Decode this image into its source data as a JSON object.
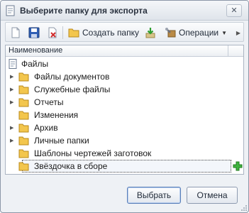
{
  "window": {
    "title": "Выберите папку для экспорта",
    "close_glyph": "✕"
  },
  "toolbar": {
    "create_folder_label": "Создать папку",
    "operations_label": "Операции",
    "operations_arrow": "▼",
    "overflow_glyph": "▶",
    "icons": [
      "new-document-icon",
      "save-icon",
      "delete-icon",
      "folder-icon",
      "refresh-icon",
      "operations-icon"
    ]
  },
  "tree": {
    "column_header": "Наименование",
    "root_label": "Файлы",
    "items": [
      {
        "label": "Файлы документов",
        "expandable": true
      },
      {
        "label": "Служебные файлы",
        "expandable": true
      },
      {
        "label": "Отчеты",
        "expandable": true
      },
      {
        "label": "Изменения",
        "expandable": false
      },
      {
        "label": "Архив",
        "expandable": true
      },
      {
        "label": "Личные папки",
        "expandable": true
      },
      {
        "label": "Шаблоны чертежей заготовок",
        "expandable": false
      },
      {
        "label": "Звёздочка в сборе",
        "expandable": false,
        "selected": true
      }
    ]
  },
  "buttons": {
    "select_label": "Выбрать",
    "cancel_label": "Отмена"
  },
  "colors": {
    "folder": "#f3c64d",
    "accent_green": "#2e9e2e"
  }
}
